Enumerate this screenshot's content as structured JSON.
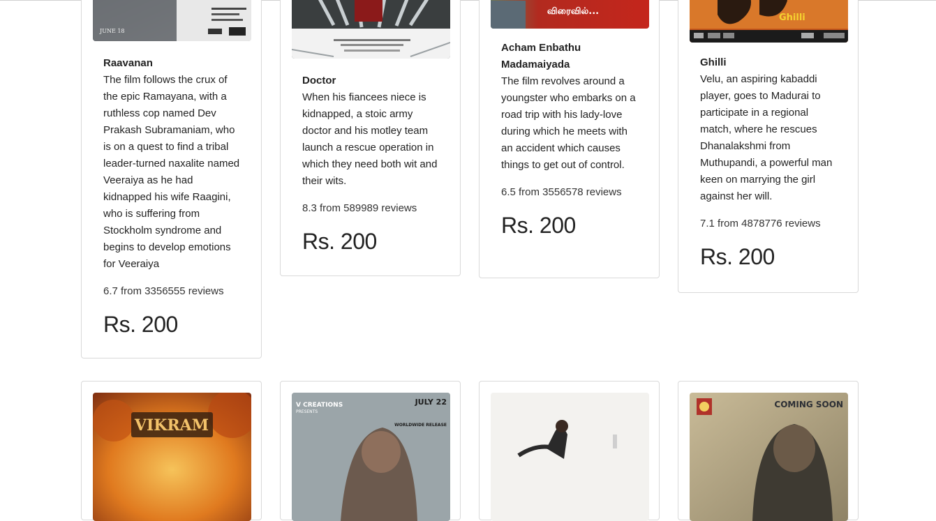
{
  "row1": [
    {
      "title": "Raavanan",
      "description": "The film follows the crux of the epic Ramayana, with a ruthless cop named Dev Prakash Subramaniam, who is on a quest to find a tribal leader-turned naxalite named Veeraiya as he had kidnapped his wife Raagini, who is suffering from Stockholm syndrome and begins to develop emotions for Veeraiya",
      "rating": "6.7 from 3356555 reviews",
      "price": "Rs. 200",
      "poster_text": "JUNE 18"
    },
    {
      "title": "Doctor",
      "description": "When his fiancees niece is kidnapped, a stoic army doctor and his motley team launch a rescue operation in which they need both wit and their wits.",
      "rating": "8.3 from 589989 reviews",
      "price": "Rs. 200",
      "poster_text": ""
    },
    {
      "title": "Acham Enbathu Madamaiyada",
      "description": "The film revolves around a youngster who embarks on a road trip with his lady-love during which he meets with an accident which causes things to get out of control.",
      "rating": "6.5 from 3556578 reviews",
      "price": "Rs. 200",
      "poster_text": "விரைவில்..."
    },
    {
      "title": "Ghilli",
      "description": "Velu, an aspiring kabaddi player, goes to Madurai to participate in a regional match, where he rescues Dhanalakshmi from Muthupandi, a powerful man keen on marrying the girl against her will.",
      "rating": "7.1 from 4878776 reviews",
      "price": "Rs. 200",
      "poster_text": "Ghilli"
    }
  ],
  "row2": [
    {
      "poster_text": "VIKRAM"
    },
    {
      "poster_text_top": "V CREATIONS",
      "poster_text_sub": "PRESENTS",
      "poster_date": "JULY 22",
      "poster_release": "WORLDWIDE RELEASE"
    },
    {
      "poster_text": ""
    },
    {
      "poster_text": "COMING SOON"
    }
  ],
  "colors": {
    "card_border": "#d9d9d9",
    "text": "#222222"
  }
}
